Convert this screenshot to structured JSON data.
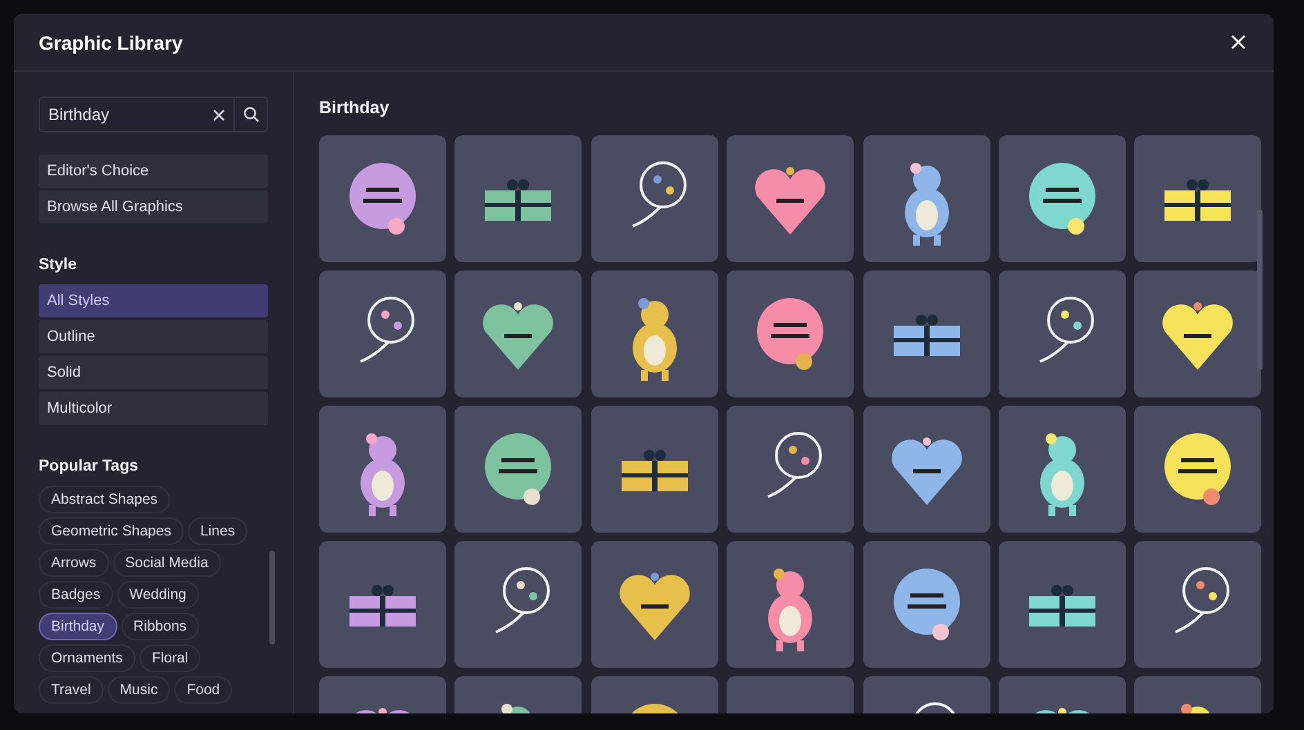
{
  "window": {
    "title": "Graphic Library"
  },
  "search": {
    "value": "Birthday"
  },
  "collections": [
    "Editor's Choice",
    "Browse All Graphics"
  ],
  "style": {
    "heading": "Style",
    "options": [
      {
        "label": "All Styles",
        "selected": true
      },
      {
        "label": "Outline",
        "selected": false
      },
      {
        "label": "Solid",
        "selected": false
      },
      {
        "label": "Multicolor",
        "selected": false
      }
    ]
  },
  "tags": {
    "heading": "Popular Tags",
    "items": [
      {
        "label": "Abstract Shapes",
        "selected": false
      },
      {
        "label": "Geometric Shapes",
        "selected": false
      },
      {
        "label": "Lines",
        "selected": false
      },
      {
        "label": "Arrows",
        "selected": false
      },
      {
        "label": "Social Media",
        "selected": false
      },
      {
        "label": "Badges",
        "selected": false
      },
      {
        "label": "Wedding",
        "selected": false
      },
      {
        "label": "Birthday",
        "selected": true
      },
      {
        "label": "Ribbons",
        "selected": false
      },
      {
        "label": "Ornaments",
        "selected": false
      },
      {
        "label": "Floral",
        "selected": false
      },
      {
        "label": "Travel",
        "selected": false
      },
      {
        "label": "Music",
        "selected": false
      },
      {
        "label": "Food",
        "selected": false
      }
    ]
  },
  "results": {
    "heading": "Birthday"
  }
}
